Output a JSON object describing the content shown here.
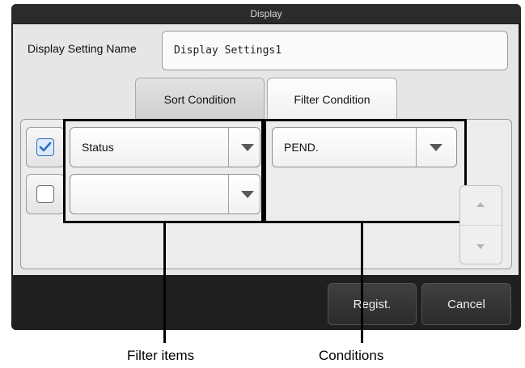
{
  "dialog": {
    "title": "Display"
  },
  "setting_name": {
    "label": "Display Setting Name",
    "value": "Display Settings1"
  },
  "tabs": [
    {
      "label": "Sort Condition",
      "selected": false
    },
    {
      "label": "Filter Condition",
      "selected": true
    }
  ],
  "rows": [
    {
      "checked": true,
      "filter_item": "Status",
      "condition": "PEND."
    },
    {
      "checked": false,
      "filter_item": "",
      "condition": ""
    }
  ],
  "footer": {
    "regist_label": "Regist.",
    "cancel_label": "Cancel"
  },
  "callouts": {
    "filter_items": "Filter items",
    "conditions": "Conditions"
  },
  "colors": {
    "checkbox_accent": "#2f6ec2",
    "dialog_bg": "#1e1e1e",
    "panel_bg": "#e6e6e6"
  }
}
